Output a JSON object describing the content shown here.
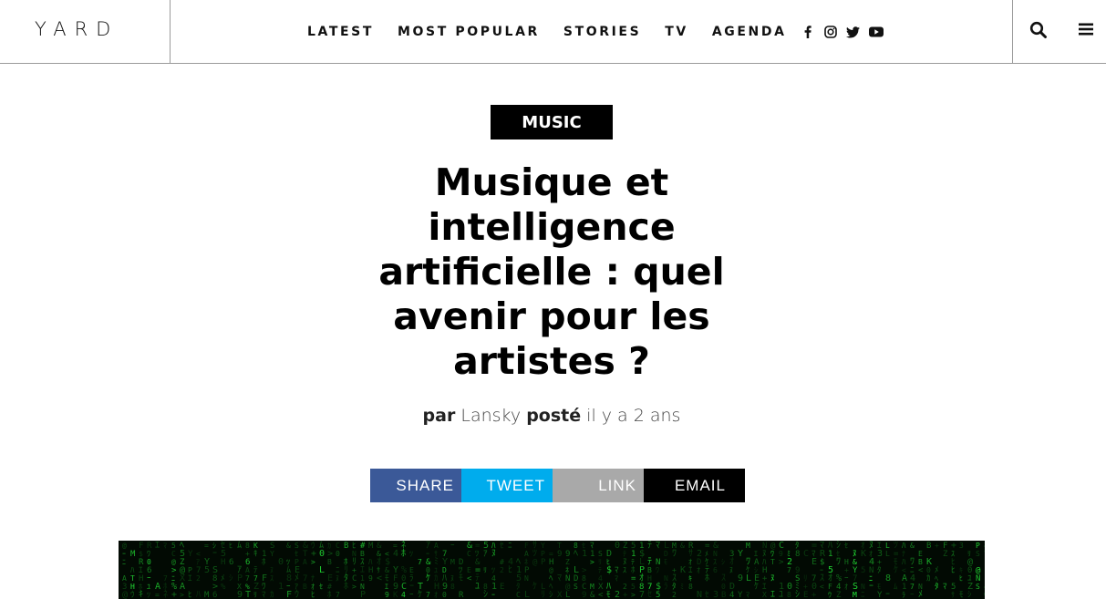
{
  "header": {
    "logo": "YARD",
    "nav": [
      "LATEST",
      "MOST POPULAR",
      "STORIES",
      "TV",
      "AGENDA"
    ],
    "social_icons": [
      "facebook-icon",
      "instagram-icon",
      "twitter-icon",
      "youtube-icon"
    ],
    "utility_icons": [
      "search-icon",
      "menu-icon"
    ]
  },
  "article": {
    "category": "MUSIC",
    "title": "Musique et intelligence artificielle : quel avenir pour les artistes ?",
    "byline": {
      "by_label": "par",
      "author": "Lansky",
      "posted_label": "posté",
      "time": "il y a 2 ans"
    },
    "share_buttons": [
      {
        "label": "SHARE",
        "color": "#3b5998"
      },
      {
        "label": "TWEET",
        "color": "#00aced"
      },
      {
        "label": "LINK",
        "color": "#a9a9a9"
      },
      {
        "label": "EMAIL",
        "color": "#000000"
      }
    ]
  },
  "colors": {
    "matrix_green": "#27ff3c",
    "hero_background": "#020a03"
  }
}
